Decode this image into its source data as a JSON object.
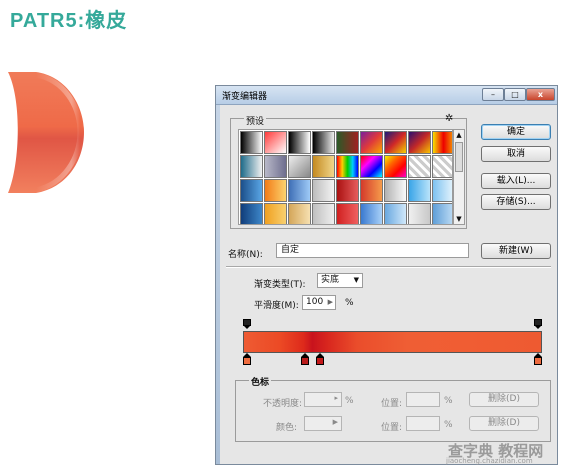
{
  "page": {
    "heading": "PATR5:橡皮"
  },
  "dialog": {
    "title": "渐变编辑器",
    "window_buttons": {
      "minimize": "–",
      "maximize": "□",
      "close": "x"
    },
    "presets": {
      "label": "预设",
      "gear_icon": "gear-icon",
      "swatches": [
        "linear-gradient(to right,#000,#fff)",
        "linear-gradient(135deg,#ff3b3b,#fff)",
        "linear-gradient(to right,#000,#fff)",
        "linear-gradient(to right,#000,#eee)",
        "linear-gradient(to right,#2a5a27,#a02121)",
        "linear-gradient(135deg,#7b1f9c,#e03a3a,#f7a800)",
        "linear-gradient(135deg,#1a1c7a,#d02828,#f5d300)",
        "linear-gradient(135deg,#2d0f70,#c22828,#f7c400)",
        "linear-gradient(to right,#f8e000,#e00,#f5a000)",
        "linear-gradient(to right,#1e6b8a,#f1f1f1)",
        "linear-gradient(to right,#b8b8c8,#6e6e8e)",
        "linear-gradient(135deg,#eee,#888)",
        "linear-gradient(to right,#c48a21,#f1d68a)",
        "linear-gradient(to right,#ff0000,#ffcc00,#00cc00,#00ccff,#0000ff)",
        "linear-gradient(135deg,#ff0000,#ff00ff,#0000ff,#00ffff)",
        "linear-gradient(135deg,#f3f300,#ff6600,#ff0000,#ff00cc)",
        "repeating-linear-gradient(45deg,#ccc 0 3px,#fff 3px 6px)",
        "repeating-linear-gradient(45deg,#ccc 0 3px,#fff 3px 6px)",
        "linear-gradient(to right,#1b4f8a,#5aa6e6)",
        "linear-gradient(to right,#f27c18,#fcd36e)",
        "linear-gradient(to right,#3f6fb6,#9ecaf7)",
        "linear-gradient(to right,#bdbdbd,#f3f3f3)",
        "linear-gradient(to right,#aa1111,#e65c5c)",
        "linear-gradient(to right,#d43a2b,#f59b4b)",
        "linear-gradient(to right,#b2b2b2,#fafafa)",
        "linear-gradient(to right,#3aa5e8,#b9e3fa)",
        "linear-gradient(to right,#7ec2f0,#e9f6fd)",
        "linear-gradient(to right,#113d7a,#3d87c9)",
        "linear-gradient(to right,#f0a020,#f8d070)",
        "linear-gradient(to right,#d4a65a,#f6e0b0)",
        "linear-gradient(to right,#c0c0c0,#eee)",
        "linear-gradient(to right,#d02020,#f06060)",
        "linear-gradient(to right,#3a7ad0,#a8d0f8)",
        "linear-gradient(to right,#6aa8e0,#d0e8fa)",
        "linear-gradient(to right,#f0f0f0,#c8c8c8)",
        "linear-gradient(to right,#5f9fd8,#c0ddf5)"
      ],
      "scroll_up_icon": "▲",
      "scroll_down_icon": "▼"
    },
    "buttons": {
      "ok": "确定",
      "cancel": "取消",
      "load": "载入(L)...",
      "save": "存储(S)...",
      "new": "新建(W)"
    },
    "name": {
      "label": "名称(N):",
      "value": "自定"
    },
    "gradient_type": {
      "label": "渐变类型(T):",
      "value": "实底",
      "dropdown_icon": "▼"
    },
    "smoothness": {
      "label": "平滑度(M):",
      "value": "100",
      "arrow_icon": "▶",
      "unit": "%"
    },
    "gradient_bar": {
      "fill": "linear-gradient(to right,#ee5b33 0%,#ec4a25 12%,#de2a1b 20%,#c8131d 23%,#d8261e 28%,#ea4d2b 38%,#ef5e34 55%,#f05d33 75%,#ee5a31 100%)",
      "color_stops": [
        {
          "position": 0.0,
          "color": "#ef6c3e",
          "selected": false
        },
        {
          "position": 0.2,
          "color": "#b81b1b",
          "selected": true
        },
        {
          "position": 0.25,
          "color": "#c4191b",
          "selected": false
        },
        {
          "position": 1.0,
          "color": "#ee6b3f",
          "selected": false
        }
      ],
      "opacity_stops": [
        {
          "position": 0.0
        },
        {
          "position": 1.0
        }
      ]
    },
    "stops": {
      "label": "色标",
      "opacity": {
        "label": "不透明度:",
        "value": "",
        "arrow_icon": "▸",
        "unit": "%"
      },
      "opacity_location": {
        "label": "位置:",
        "value": "",
        "unit": "%"
      },
      "opacity_delete": "删除(D)",
      "color": {
        "label": "颜色:",
        "arrow_icon": "▶"
      },
      "color_location": {
        "label": "位置:",
        "value": "",
        "unit": "%"
      },
      "color_delete": "删除(D)"
    }
  },
  "watermark": {
    "text": "查字典 教程网",
    "url": "jiaocheng.chazidian.com"
  }
}
